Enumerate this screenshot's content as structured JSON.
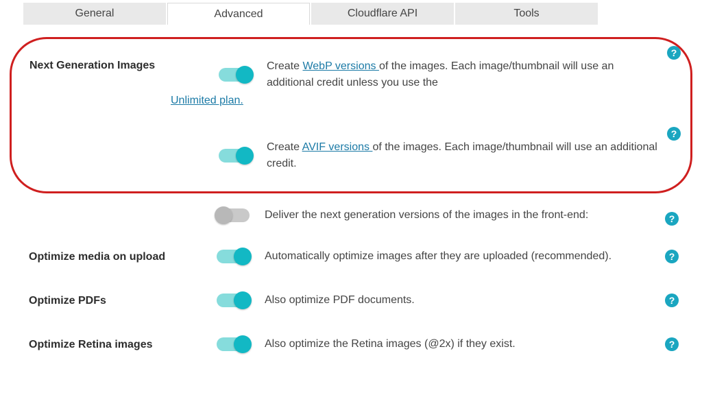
{
  "tabs": {
    "general": "General",
    "advanced": "Advanced",
    "cloudflare": "Cloudflare API",
    "tools": "Tools",
    "active": "advanced"
  },
  "help_glyph": "?",
  "sections": {
    "nextgen": {
      "title": "Next Generation Images",
      "webp": {
        "pre": "Create ",
        "link": "WebP versions ",
        "mid": "of the images. Each image/thumbnail will use an additional credit unless you use the ",
        "plan_link": "Unlimited plan.",
        "on": true
      },
      "avif": {
        "pre": "Create ",
        "link": "AVIF versions ",
        "post": "of the images. Each image/thumbnail will use an additional credit.",
        "on": true
      },
      "deliver": {
        "text": "Deliver the next generation versions of the images in the front-end:",
        "on": false
      }
    },
    "upload": {
      "title": "Optimize media on upload",
      "text": "Automatically optimize images after they are uploaded (recommended).",
      "on": true
    },
    "pdfs": {
      "title": "Optimize PDFs",
      "text": "Also optimize PDF documents.",
      "on": true
    },
    "retina": {
      "title": "Optimize Retina images",
      "text": "Also optimize the Retina images (@2x) if they exist.",
      "on": true
    }
  }
}
